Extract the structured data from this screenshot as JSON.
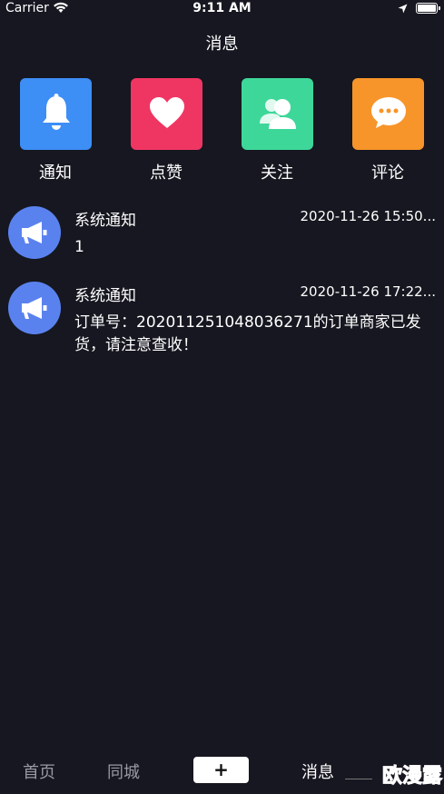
{
  "status_bar": {
    "carrier": "Carrier",
    "time": "9:11 AM"
  },
  "nav": {
    "title": "消息"
  },
  "categories": [
    {
      "label": "通知",
      "icon": "bell-icon",
      "color": "#3d8ef5"
    },
    {
      "label": "点赞",
      "icon": "heart-icon",
      "color": "#ef3663"
    },
    {
      "label": "关注",
      "icon": "contacts-icon",
      "color": "#3ed79a"
    },
    {
      "label": "评论",
      "icon": "chat-bubble-icon",
      "color": "#f7952a"
    }
  ],
  "messages": [
    {
      "title": "系统通知",
      "time": "2020-11-26 15:50...",
      "body": "1",
      "icon": "megaphone-icon"
    },
    {
      "title": "系统通知",
      "time": "2020-11-26 17:22...",
      "body": "订单号：202011251048036271的订单商家已发货，请注意查收！",
      "icon": "megaphone-icon"
    }
  ],
  "tabs": [
    {
      "label": "首页",
      "active": false
    },
    {
      "label": "同城",
      "active": false
    },
    {
      "label": "+",
      "active": false
    },
    {
      "label": "消息",
      "active": true
    }
  ],
  "watermark": "欧漫露"
}
